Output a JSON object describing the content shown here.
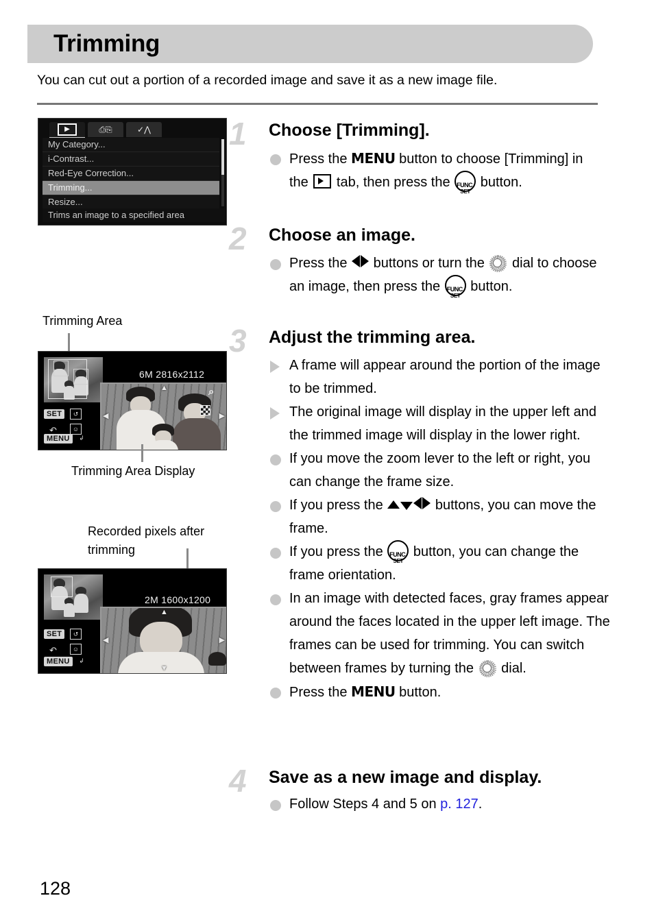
{
  "page": {
    "title": "Trimming",
    "intro": "You can cut out a portion of a recorded image and save it as a new image file.",
    "page_number": "128"
  },
  "menu_screen": {
    "tabs": [
      {
        "name": "playback-tab",
        "icon": "play-icon",
        "selected": true
      },
      {
        "name": "print-tab",
        "icon": "printer-icon",
        "selected": false
      },
      {
        "name": "settings-tab",
        "icon": "wrench-hammer-icon",
        "selected": false
      }
    ],
    "items": [
      {
        "label": "My Category...",
        "highlighted": false
      },
      {
        "label": "i-Contrast...",
        "highlighted": false
      },
      {
        "label": "Red-Eye Correction...",
        "highlighted": false
      },
      {
        "label": "Trimming...",
        "highlighted": true
      },
      {
        "label": "Resize...",
        "highlighted": false
      }
    ],
    "hint": "Trims an image to a specified area"
  },
  "figure_one": {
    "callout": "Trimming Area",
    "caption": "Trimming Area Display",
    "resolution": "6M 2816x2112",
    "set_badge": "SET",
    "menu_badge": "MENU"
  },
  "figure_two": {
    "callout": "Recorded pixels after\ntrimming",
    "resolution": "2M 1600x1200",
    "set_badge": "SET",
    "menu_badge": "MENU"
  },
  "steps": [
    {
      "number": "1",
      "heading": "Choose [Trimming].",
      "bullets": [
        {
          "type": "dot",
          "parts": [
            {
              "t": "text",
              "v": "Press the "
            },
            {
              "t": "menu-word",
              "v": "MENU"
            },
            {
              "t": "text",
              "v": " button to choose [Trimming] in the "
            },
            {
              "t": "icon",
              "v": "play-icon"
            },
            {
              "t": "text",
              "v": " tab, then press the "
            },
            {
              "t": "icon",
              "v": "func-set-icon"
            },
            {
              "t": "text",
              "v": " button."
            }
          ]
        }
      ]
    },
    {
      "number": "2",
      "heading": "Choose an image.",
      "bullets": [
        {
          "type": "dot",
          "parts": [
            {
              "t": "text",
              "v": "Press the "
            },
            {
              "t": "icon",
              "v": "left-arrow-icon"
            },
            {
              "t": "icon",
              "v": "right-arrow-icon"
            },
            {
              "t": "text",
              "v": " buttons or turn the "
            },
            {
              "t": "icon",
              "v": "control-dial-icon"
            },
            {
              "t": "text",
              "v": " dial to choose an image, then press the "
            },
            {
              "t": "icon",
              "v": "func-set-icon"
            },
            {
              "t": "text",
              "v": " button."
            }
          ]
        }
      ]
    },
    {
      "number": "3",
      "heading": "Adjust the trimming area.",
      "bullets": [
        {
          "type": "triangle",
          "parts": [
            {
              "t": "text",
              "v": "A frame will appear around the portion of the image to be trimmed."
            }
          ]
        },
        {
          "type": "triangle",
          "parts": [
            {
              "t": "text",
              "v": "The original image will display in the upper left and the trimmed image will display in the lower right."
            }
          ]
        },
        {
          "type": "dot",
          "parts": [
            {
              "t": "text",
              "v": "If you move the zoom lever to the left or right, you can change the frame size."
            }
          ]
        },
        {
          "type": "dot",
          "parts": [
            {
              "t": "text",
              "v": "If you press the "
            },
            {
              "t": "icon",
              "v": "up-arrow-icon"
            },
            {
              "t": "icon",
              "v": "down-arrow-icon"
            },
            {
              "t": "icon",
              "v": "left-arrow-icon"
            },
            {
              "t": "icon",
              "v": "right-arrow-icon"
            },
            {
              "t": "text",
              "v": " buttons, you can move the frame."
            }
          ]
        },
        {
          "type": "dot",
          "parts": [
            {
              "t": "text",
              "v": "If you press the "
            },
            {
              "t": "icon",
              "v": "func-set-icon"
            },
            {
              "t": "text",
              "v": " button, you can change the frame orientation."
            }
          ]
        },
        {
          "type": "dot",
          "parts": [
            {
              "t": "text",
              "v": "In an image with detected faces, gray frames appear around the faces located in the upper left image. The frames can be used for trimming. You can switch between frames by turning the "
            },
            {
              "t": "icon",
              "v": "control-dial-icon"
            },
            {
              "t": "text",
              "v": " dial."
            }
          ]
        },
        {
          "type": "dot",
          "parts": [
            {
              "t": "text",
              "v": "Press the "
            },
            {
              "t": "menu-word",
              "v": "MENU"
            },
            {
              "t": "text",
              "v": " button."
            }
          ]
        }
      ]
    },
    {
      "number": "4",
      "heading": "Save as a new image and display.",
      "bullets": [
        {
          "type": "dot",
          "parts": [
            {
              "t": "text",
              "v": "Follow Steps 4 and 5 on "
            },
            {
              "t": "link",
              "v": "p. 127"
            },
            {
              "t": "text",
              "v": "."
            }
          ]
        }
      ]
    }
  ],
  "colors": {
    "header_band": "#cccccc",
    "rule": "#777777",
    "step_number": "#d2d2d2",
    "bullet": "#c6c6c6",
    "link": "#2222dd"
  }
}
